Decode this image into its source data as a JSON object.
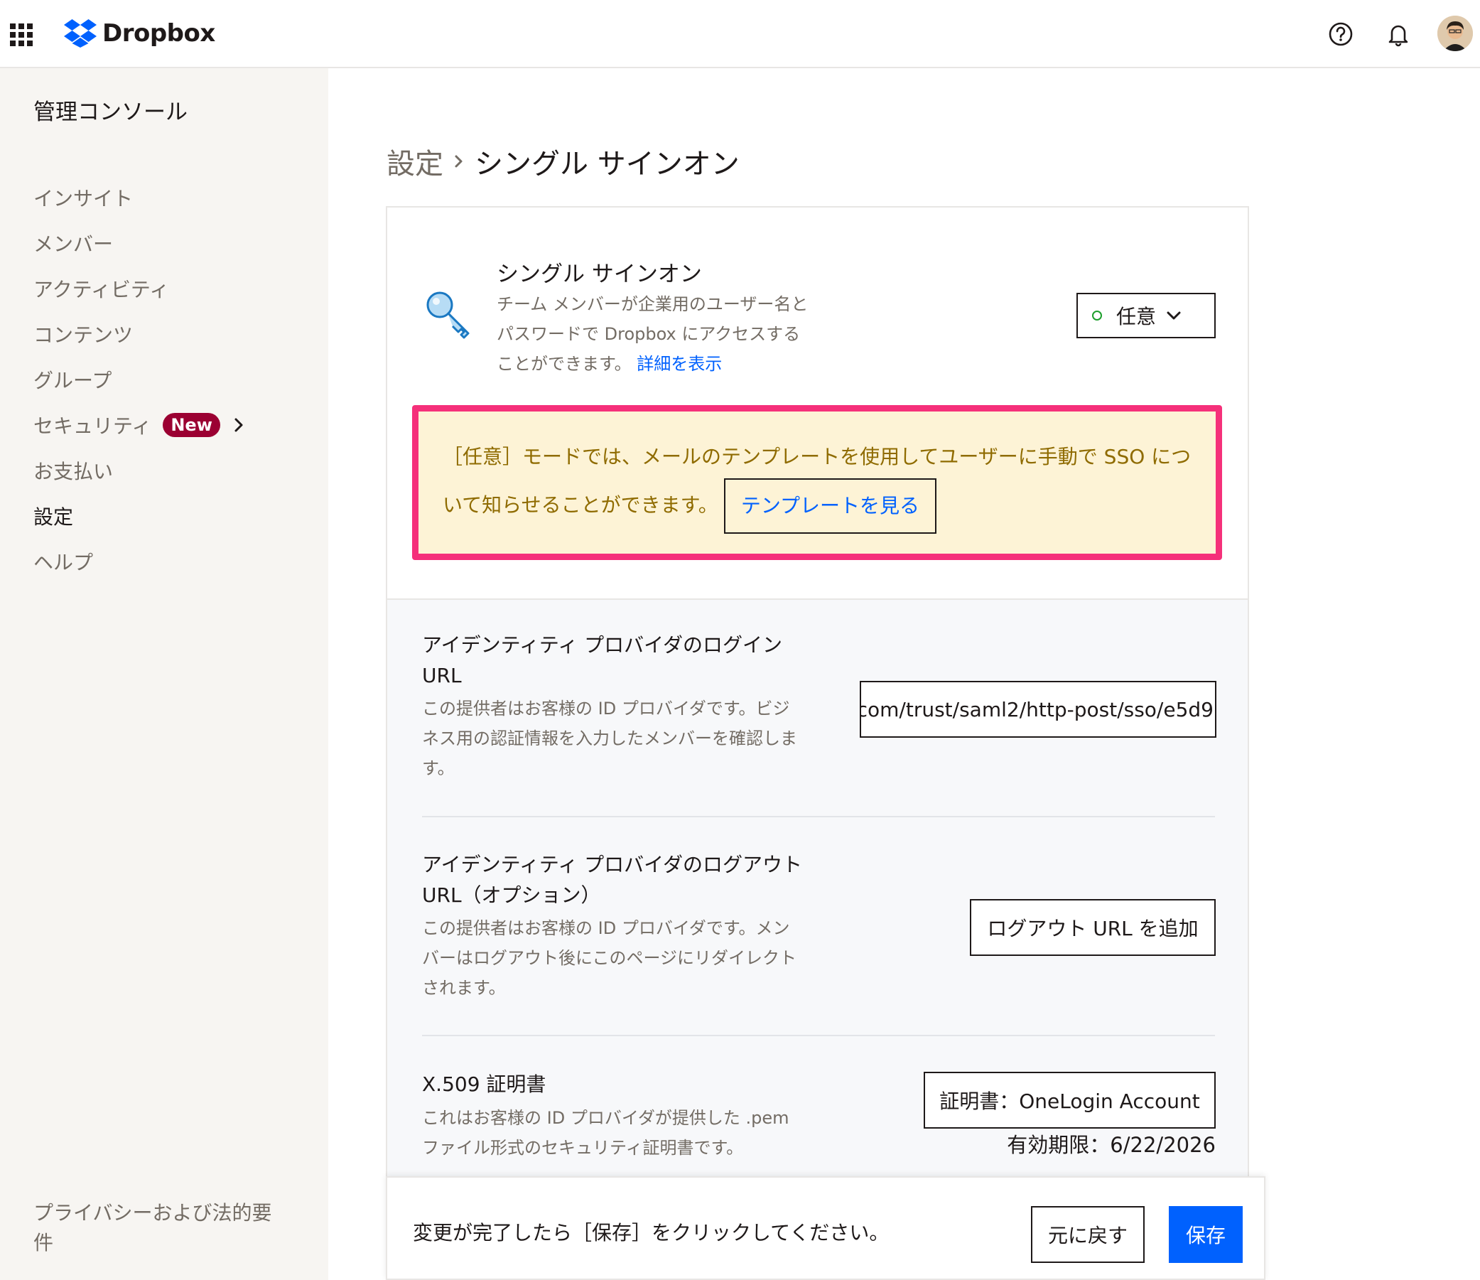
{
  "header": {
    "brand": "Dropbox",
    "icons": [
      "apps-grid-icon",
      "dropbox-logo-icon",
      "help-icon",
      "bell-icon",
      "avatar"
    ]
  },
  "sidebar": {
    "title": "管理コンソール",
    "items": [
      {
        "label": "インサイト"
      },
      {
        "label": "メンバー"
      },
      {
        "label": "アクティビティ"
      },
      {
        "label": "コンテンツ"
      },
      {
        "label": "グループ"
      },
      {
        "label": "セキュリティ",
        "badge": "New"
      },
      {
        "label": "お支払い"
      },
      {
        "label": "設定",
        "active": true
      },
      {
        "label": "ヘルプ"
      }
    ],
    "footer_link": "プライバシーおよび法的要件"
  },
  "breadcrumb": {
    "parent": "設定",
    "current": "シングル サインオン"
  },
  "sso": {
    "title": "シングル サインオン",
    "description": "チーム メンバーが企業用のユーザー名とパスワードで Dropbox にアクセスすることができます。",
    "details_link": "詳細を表示",
    "mode_value": "任意",
    "mode_status_color": "#1d9e2c"
  },
  "notice": {
    "text": "［任意］モードでは、メールのテンプレートを使用してユーザーに手動で SSO について知らせることができます。",
    "button": "テンプレートを見る"
  },
  "login_url": {
    "title": "アイデンティティ プロバイダのログイン URL",
    "description": "この提供者はお客様の ID プロバイダです。ビジネス用の認証情報を入力したメンバーを確認します。",
    "value": "com/trust/saml2/http-post/sso/e5d9"
  },
  "logout_url": {
    "title": "アイデンティティ プロバイダのログアウト URL（オプション）",
    "description": "この提供者はお客様の ID プロバイダです。メンバーはログアウト後にこのページにリダイレクトされます。",
    "button": "ログアウト URL を追加"
  },
  "certificate": {
    "title": "X.509 証明書",
    "description": "これはお客様の ID プロバイダが提供した .pem ファイル形式のセキュリティ証明書です。",
    "button": "証明書：OneLogin Account",
    "expiry": "有効期限：6/22/2026"
  },
  "footer": {
    "message": "変更が完了したら［保存］をクリックしてください。",
    "revert": "元に戻す",
    "save": "保存"
  },
  "colors": {
    "accent": "#0061fe",
    "highlight_border": "#f5307a",
    "notice_bg": "#fdf3d6",
    "badge": "#9b0032"
  }
}
